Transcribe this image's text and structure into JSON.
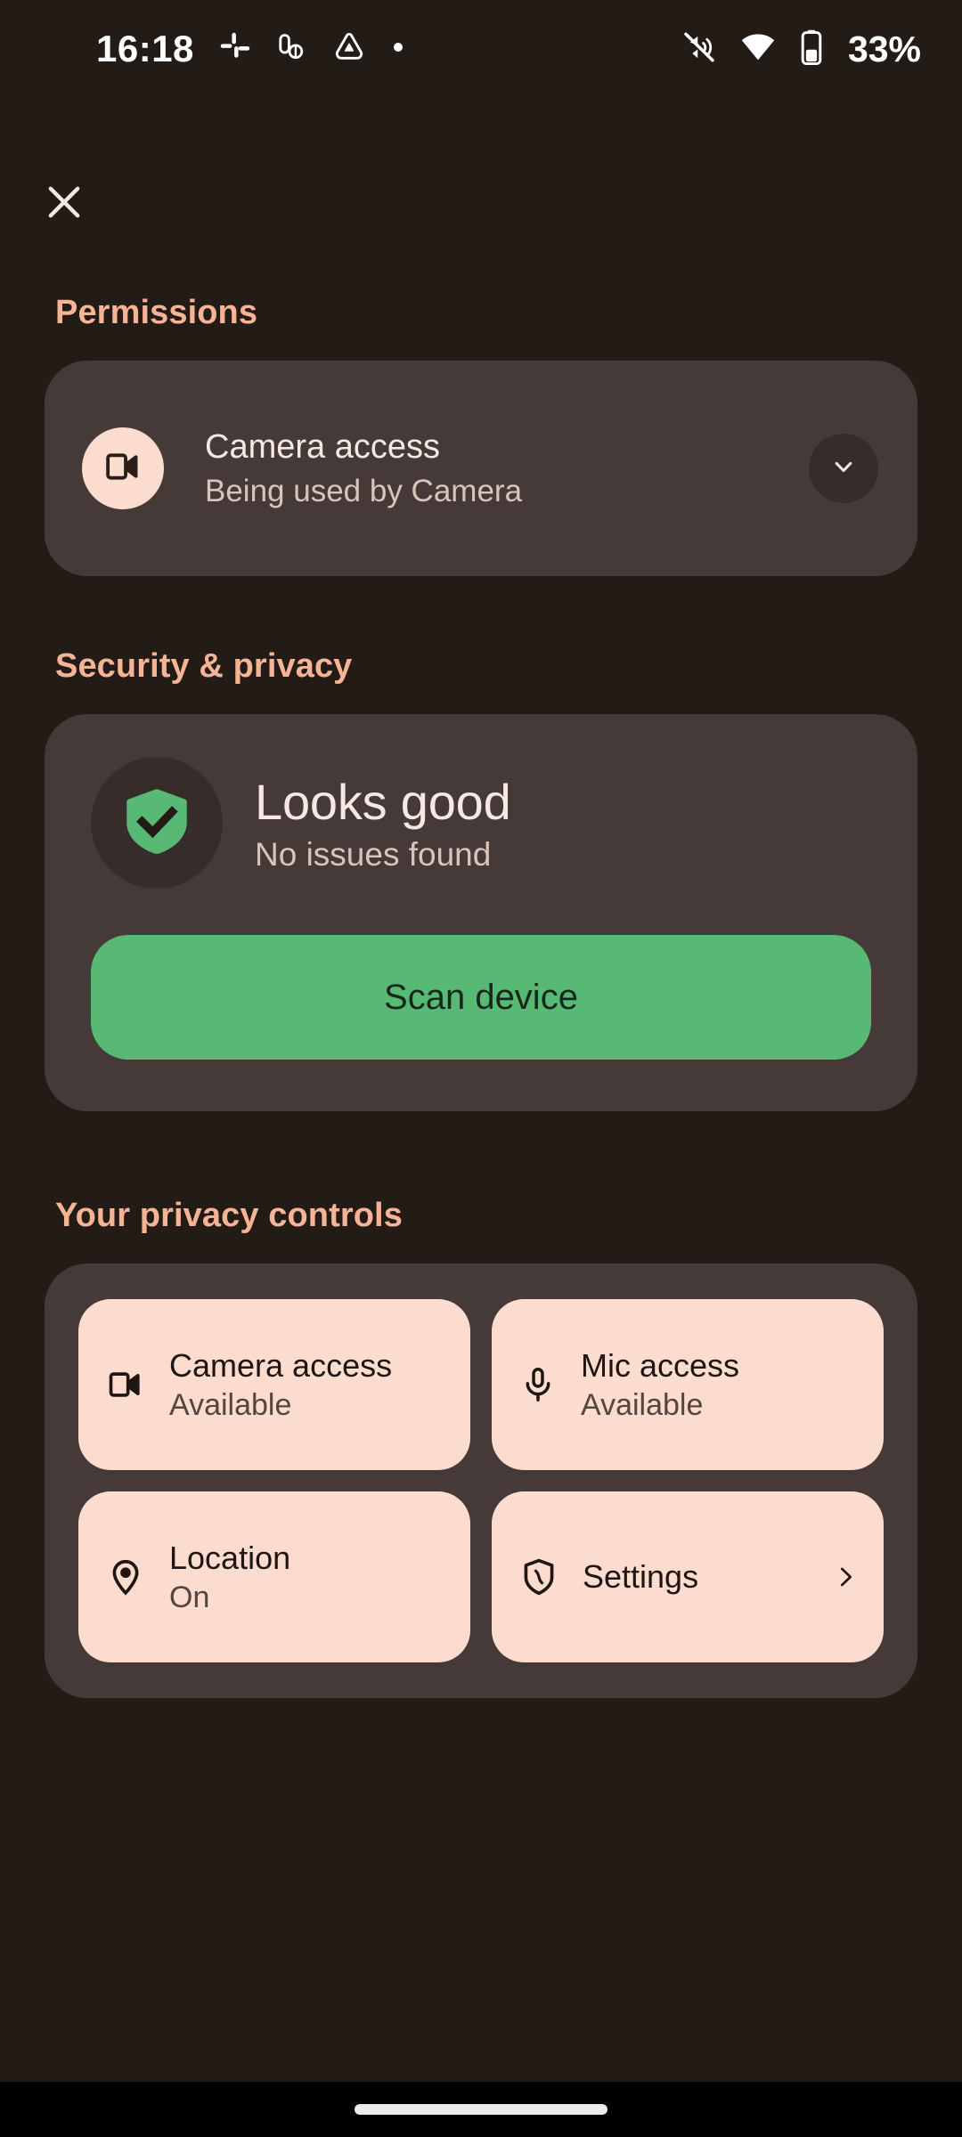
{
  "status_bar": {
    "clock": "16:18",
    "battery_text": "33%",
    "left_icons": [
      "slack-notification-icon",
      "app-notification-icon",
      "drive-notification-icon",
      "more-notifications-dot-icon"
    ],
    "right_icons": [
      "volume-mute-icon",
      "wifi-icon",
      "battery-icon"
    ]
  },
  "top_bar": {
    "close_icon": "close-icon"
  },
  "permissions": {
    "header": "Permissions",
    "item": {
      "icon": "camera-icon",
      "title": "Camera access",
      "subtitle": "Being used by Camera",
      "expand_icon": "chevron-down-icon"
    }
  },
  "security": {
    "header": "Security & privacy",
    "status_icon": "shield-check-icon",
    "title": "Looks good",
    "subtitle": "No issues found",
    "scan_button_label": "Scan device"
  },
  "privacy_controls": {
    "header": "Your privacy controls",
    "tiles": [
      {
        "icon": "camera-icon",
        "title": "Camera access",
        "subtitle": "Available",
        "chevron": ""
      },
      {
        "icon": "microphone-icon",
        "title": "Mic access",
        "subtitle": "Available",
        "chevron": ""
      },
      {
        "icon": "location-pin-icon",
        "title": "Location",
        "subtitle": "On",
        "chevron": ""
      },
      {
        "icon": "shield-icon",
        "title": "Settings",
        "subtitle": "",
        "chevron": "chevron-right-icon"
      }
    ]
  },
  "nav_bar": {
    "handle": "home-gesture-handle"
  },
  "colors": {
    "page_background": "#231b16",
    "card_background": "#453a37",
    "accent_header": "#f7b396",
    "tile_peach": "#fcdccf",
    "green_accent": "#58b974",
    "primary_text": "#f6e9e4",
    "secondary_text": "#d7c5bd"
  }
}
